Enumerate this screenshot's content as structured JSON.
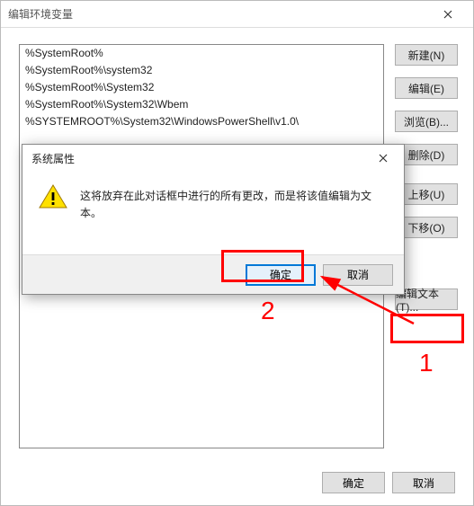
{
  "parent": {
    "title": "编辑环境变量",
    "list_items": [
      "%SystemRoot%",
      "%SystemRoot%\\system32",
      "%SystemRoot%\\System32",
      "%SystemRoot%\\System32\\Wbem",
      "%SYSTEMROOT%\\System32\\WindowsPowerShell\\v1.0\\"
    ],
    "buttons": {
      "new": "新建(N)",
      "edit": "编辑(E)",
      "browse": "浏览(B)...",
      "delete": "删除(D)",
      "moveup": "上移(U)",
      "movedown": "下移(O)",
      "edittext": "编辑文本(T)..."
    },
    "footer": {
      "ok": "确定",
      "cancel": "取消"
    }
  },
  "modal": {
    "title": "系统属性",
    "message": "这将放弃在此对话框中进行的所有更改，而是将该值编辑为文本。",
    "ok": "确定",
    "cancel": "取消"
  },
  "annotations": {
    "num1": "1",
    "num2": "2"
  }
}
